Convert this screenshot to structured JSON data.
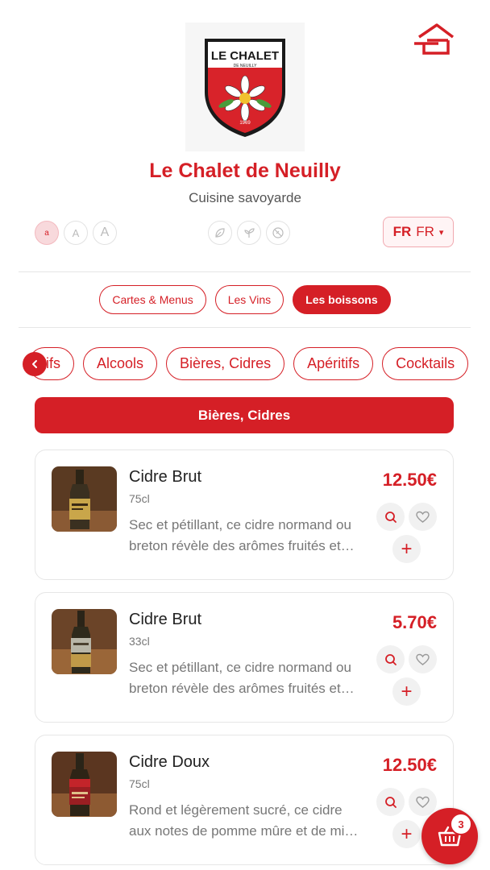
{
  "restaurant": {
    "name": "Le Chalet de Neuilly",
    "subtitle": "Cuisine savoyarde",
    "logo_text": "LE CHALET",
    "logo_subtext": "DE NEUILLY",
    "logo_year": "1969"
  },
  "font_size_buttons": [
    "a",
    "A",
    "A"
  ],
  "diet_filters": [
    "leaf-icon",
    "sprout-icon",
    "no-gluten-icon"
  ],
  "language": {
    "flag": "FR",
    "code": "FR",
    "caret": "▾"
  },
  "tabs": [
    {
      "label": "Cartes & Menus",
      "active": false
    },
    {
      "label": "Les Vins",
      "active": false
    },
    {
      "label": "Les boissons",
      "active": true
    }
  ],
  "categories": [
    "tifs",
    "Alcools",
    "Bières, Cidres",
    "Apéritifs",
    "Cocktails"
  ],
  "section_title": "Bières, Cidres",
  "products": [
    {
      "name": "Cidre Brut",
      "size": "75cl",
      "description": "Sec et pétillant, ce cidre normand ou breton révèle des arômes fruités et…",
      "price": "12.50€",
      "plus": "+"
    },
    {
      "name": "Cidre Brut",
      "size": "33cl",
      "description": "Sec et pétillant, ce cidre normand ou breton révèle des arômes fruités et…",
      "price": "5.70€",
      "plus": "+"
    },
    {
      "name": "Cidre Doux",
      "size": "75cl",
      "description": "Rond et légèrement sucré, ce cidre aux notes de pomme mûre et de mi…",
      "price": "12.50€",
      "plus": "+"
    }
  ],
  "cart": {
    "count": "3"
  },
  "colors": {
    "accent": "#d51f26",
    "accent_light": "#f8d9dc"
  }
}
